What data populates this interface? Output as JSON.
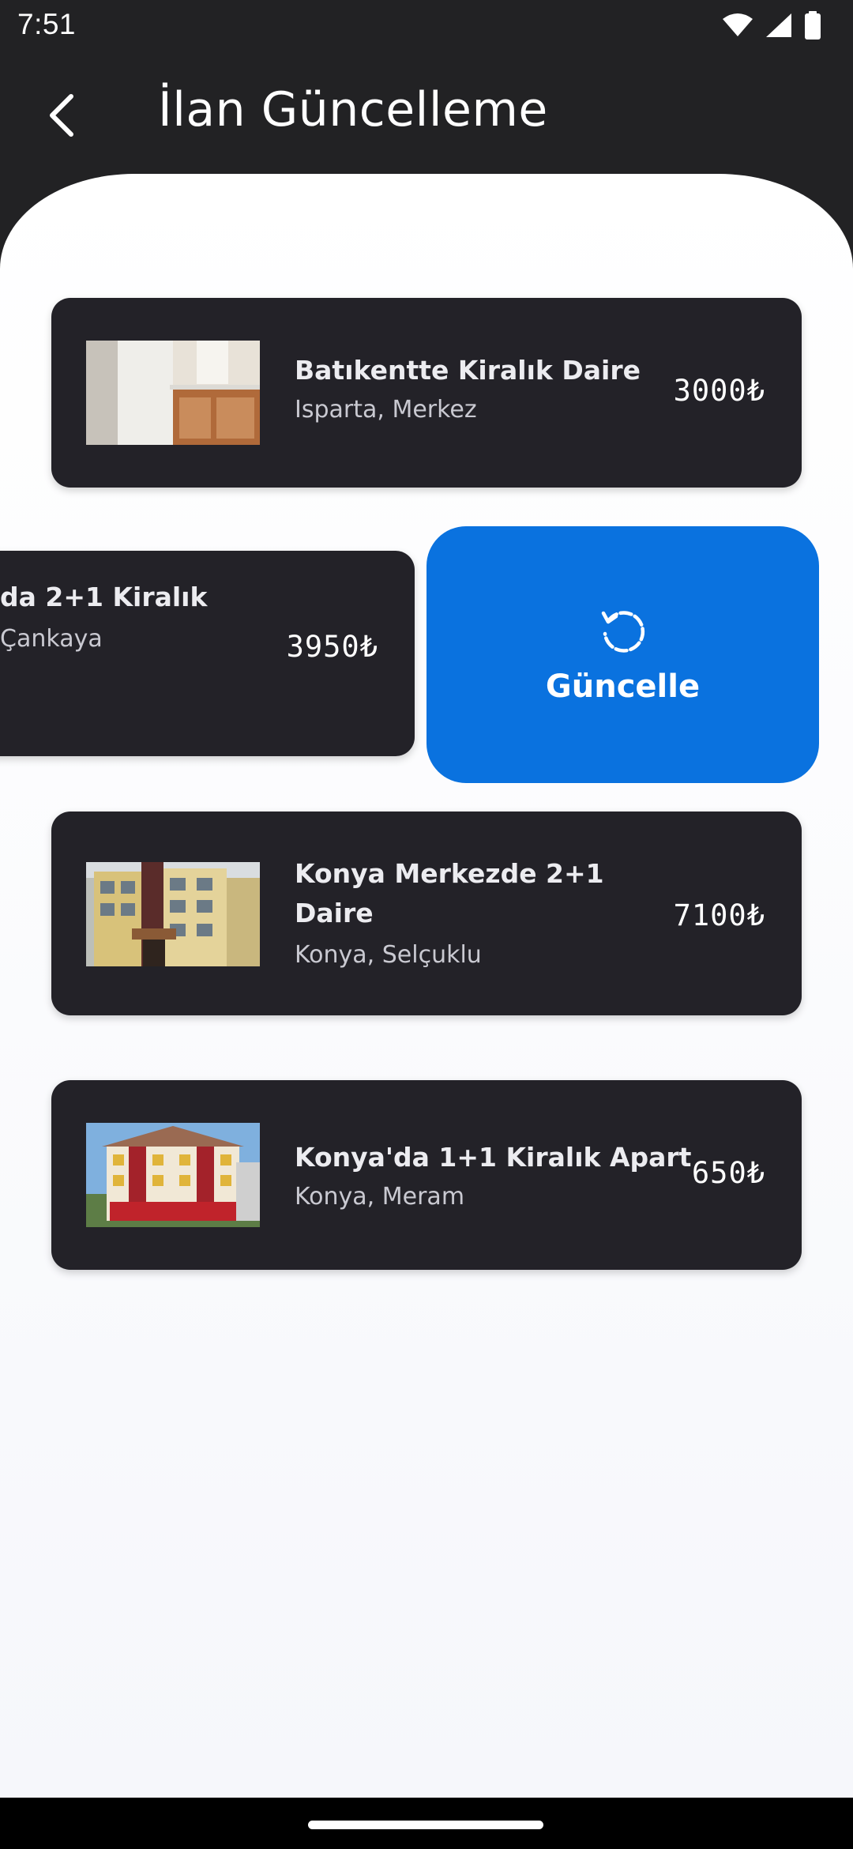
{
  "status": {
    "time": "7:51",
    "icons": [
      "wifi-icon",
      "cell-signal-icon",
      "battery-icon"
    ]
  },
  "header": {
    "title": "İlan Güncelleme",
    "back_icon": "arrow-back-icon"
  },
  "listings": [
    {
      "title": "Batıkentte Kiralık Daire",
      "location": "Isparta, Merkez",
      "price": "3000₺",
      "image": "kitchen-interior-photo"
    },
    {
      "title": "da 2+1 Kiralık",
      "location": "Çankaya",
      "price": "3950₺",
      "image": "hidden"
    },
    {
      "title": "Konya Merkezde 2+1 Daire",
      "title_line1": "Konya Merkezde 2+1",
      "title_line2": "Daire",
      "location": "Konya, Selçuklu",
      "price": "7100₺",
      "image": "apartment-building-photo"
    },
    {
      "title": "Konya'da 1+1 Kiralık Apart",
      "location": "Konya, Meram",
      "price": "650₺",
      "image": "apart-building-photo"
    }
  ],
  "swipe_action": {
    "label": "Güncelle",
    "icon": "refresh-icon"
  },
  "colors": {
    "background": "#222224",
    "card": "#232228",
    "action_blue": "#0a72df",
    "sheet": "#f6f7fb"
  }
}
